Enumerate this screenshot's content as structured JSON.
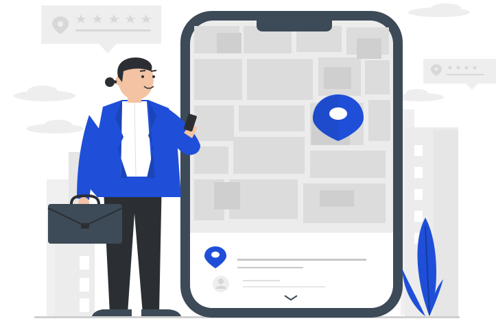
{
  "illustration": {
    "accent_color": "#1f4fd8",
    "dark_color": "#3d4a57",
    "light_gray": "#eeeeee",
    "mid_gray": "#e2e2e2",
    "review_bubbles": [
      {
        "icon": "location-pin-icon",
        "stars": 5
      },
      {
        "icon": "location-pin-icon",
        "stars": 4
      }
    ],
    "phone": {
      "map_pin_icon": "location-pin-icon",
      "card_pin_icon": "location-pin-icon",
      "card_avatar_icon": "user-avatar-icon",
      "expand_icon": "chevron-down-icon"
    },
    "person": {
      "holding": [
        "briefcase",
        "smartphone"
      ]
    },
    "plant_icon": "leaf-plant-icon"
  }
}
